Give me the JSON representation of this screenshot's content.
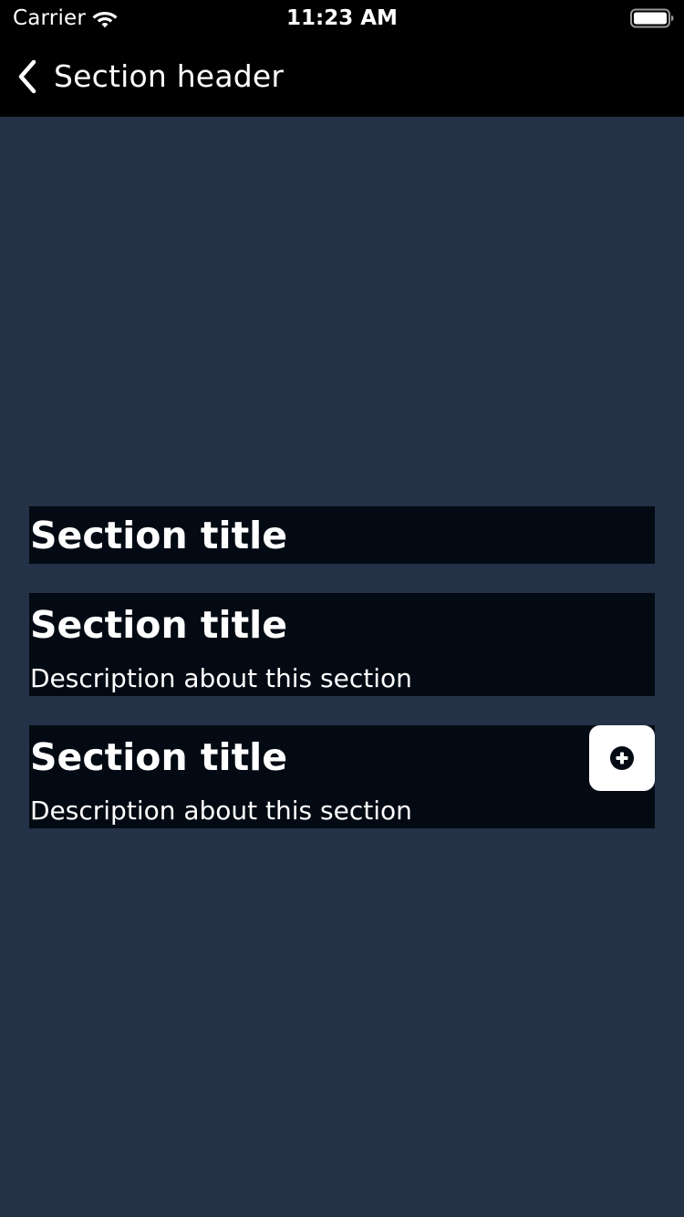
{
  "status_bar": {
    "carrier": "Carrier",
    "time": "11:23 AM",
    "icons": [
      "wifi-icon",
      "battery-icon"
    ]
  },
  "nav": {
    "back_icon": "chevron-left-icon",
    "title": "Section header"
  },
  "sections": [
    {
      "title": "Section title"
    },
    {
      "title": "Section title",
      "description": "Description about this section"
    },
    {
      "title": "Section title",
      "description": "Description about this section",
      "action_icon": "add-circle-icon"
    }
  ],
  "colors": {
    "background": "#243247",
    "bar_background": "#000000",
    "section_background": "#030a13",
    "text": "#ffffff",
    "action_button_background": "#ffffff"
  }
}
